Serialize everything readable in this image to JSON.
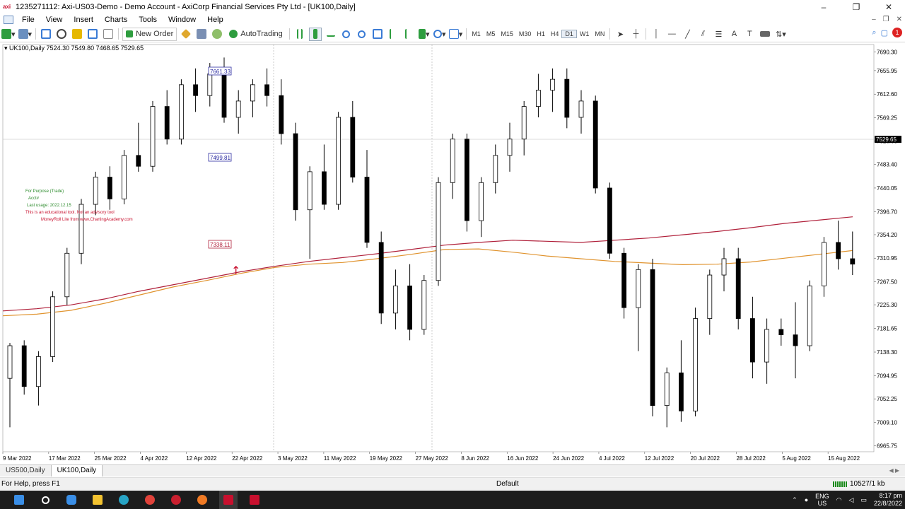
{
  "window": {
    "title": "1235271112: Axi-US03-Demo - Demo Account - AxiCorp Financial Services Pty Ltd - [UK100,Daily]",
    "logo": "axi",
    "min": "–",
    "max": "❐",
    "close": "✕"
  },
  "menu": [
    "File",
    "View",
    "Insert",
    "Charts",
    "Tools",
    "Window",
    "Help"
  ],
  "toolbar": {
    "new_order": "New Order",
    "autotrading": "AutoTrading",
    "timeframes": [
      "M1",
      "M5",
      "M15",
      "M30",
      "H1",
      "H4",
      "D1",
      "W1",
      "MN"
    ],
    "active_timeframe": "D1",
    "text_tool": "A",
    "alert_count": "1"
  },
  "chart": {
    "header": "UK100,Daily  7524.30 7549.80 7468.65 7529.65",
    "annotations": {
      "high_label": "7661.33",
      "mid_label": "7499.81",
      "low_label": "7338.11",
      "overlay_line1": "For Purpose (Trade)",
      "overlay_line2": "Acct#",
      "overlay_line3": "Last usage: 2022.12.15",
      "overlay_line4": "This is an educational tool. Not an advisory tool",
      "overlay_line5": "MoneyRoll Lite from www.ChartingAcademy.com"
    },
    "current_price": "7529.65"
  },
  "chart_data": {
    "type": "candlestick",
    "symbol": "UK100",
    "timeframe": "Daily",
    "y_ticks": [
      "7690.30",
      "7655.95",
      "7612.60",
      "7569.25",
      "7526.65",
      "7483.40",
      "7440.05",
      "7396.70",
      "7354.20",
      "7310.95",
      "7267.50",
      "7225.30",
      "7181.65",
      "7138.30",
      "7094.95",
      "7052.25",
      "7009.10",
      "6965.75"
    ],
    "ylim": [
      6955,
      7700
    ],
    "x_ticks": [
      "9 Mar 2022",
      "17 Mar 2022",
      "25 Mar 2022",
      "4 Apr 2022",
      "12 Apr 2022",
      "22 Apr 2022",
      "3 May 2022",
      "11 May 2022",
      "19 May 2022",
      "27 May 2022",
      "8 Jun 2022",
      "16 Jun 2022",
      "24 Jun 2022",
      "4 Jul 2022",
      "12 Jul 2022",
      "20 Jul 2022",
      "28 Jul 2022",
      "5 Aug 2022",
      "15 Aug 2022"
    ],
    "ma_red": [
      7214,
      7218,
      7225,
      7236,
      7250,
      7262,
      7274,
      7286,
      7296,
      7305,
      7312,
      7319,
      7327,
      7335,
      7340,
      7344,
      7342,
      7340,
      7344,
      7348,
      7354,
      7360,
      7367,
      7375,
      7381,
      7387
    ],
    "ma_orange": [
      7205,
      7208,
      7215,
      7228,
      7243,
      7258,
      7270,
      7283,
      7294,
      7300,
      7303,
      7310,
      7318,
      7327,
      7328,
      7322,
      7315,
      7310,
      7305,
      7302,
      7299,
      7300,
      7304,
      7311,
      7318,
      7325
    ],
    "candles": [
      [
        7090,
        7155,
        7000,
        7150
      ],
      [
        7150,
        7160,
        7060,
        7075
      ],
      [
        7075,
        7140,
        7040,
        7130
      ],
      [
        7130,
        7250,
        7120,
        7240
      ],
      [
        7240,
        7330,
        7225,
        7320
      ],
      [
        7320,
        7420,
        7300,
        7410
      ],
      [
        7410,
        7470,
        7390,
        7460
      ],
      [
        7460,
        7480,
        7400,
        7420
      ],
      [
        7420,
        7510,
        7410,
        7500
      ],
      [
        7500,
        7560,
        7470,
        7480
      ],
      [
        7480,
        7600,
        7470,
        7590
      ],
      [
        7590,
        7620,
        7520,
        7530
      ],
      [
        7530,
        7640,
        7520,
        7630
      ],
      [
        7630,
        7660,
        7580,
        7610
      ],
      [
        7610,
        7670,
        7590,
        7650
      ],
      [
        7650,
        7680,
        7560,
        7570
      ],
      [
        7570,
        7620,
        7540,
        7600
      ],
      [
        7600,
        7640,
        7570,
        7630
      ],
      [
        7630,
        7660,
        7590,
        7610
      ],
      [
        7610,
        7640,
        7520,
        7540
      ],
      [
        7540,
        7560,
        7380,
        7400
      ],
      [
        7400,
        7480,
        7310,
        7470
      ],
      [
        7470,
        7520,
        7400,
        7410
      ],
      [
        7410,
        7580,
        7400,
        7570
      ],
      [
        7570,
        7600,
        7450,
        7460
      ],
      [
        7460,
        7510,
        7330,
        7340
      ],
      [
        7340,
        7360,
        7190,
        7210
      ],
      [
        7210,
        7290,
        7180,
        7260
      ],
      [
        7260,
        7300,
        7160,
        7180
      ],
      [
        7180,
        7280,
        7170,
        7270
      ],
      [
        7270,
        7460,
        7260,
        7450
      ],
      [
        7450,
        7540,
        7420,
        7530
      ],
      [
        7530,
        7540,
        7360,
        7380
      ],
      [
        7380,
        7460,
        7350,
        7450
      ],
      [
        7450,
        7520,
        7430,
        7500
      ],
      [
        7500,
        7560,
        7470,
        7530
      ],
      [
        7530,
        7600,
        7500,
        7590
      ],
      [
        7590,
        7650,
        7570,
        7620
      ],
      [
        7620,
        7660,
        7580,
        7640
      ],
      [
        7640,
        7660,
        7550,
        7570
      ],
      [
        7570,
        7620,
        7540,
        7600
      ],
      [
        7600,
        7610,
        7430,
        7440
      ],
      [
        7440,
        7450,
        7310,
        7320
      ],
      [
        7320,
        7330,
        7200,
        7220
      ],
      [
        7220,
        7300,
        7140,
        7290
      ],
      [
        7290,
        7310,
        7020,
        7040
      ],
      [
        7040,
        7110,
        7000,
        7100
      ],
      [
        7100,
        7160,
        7010,
        7030
      ],
      [
        7030,
        7220,
        7020,
        7200
      ],
      [
        7200,
        7290,
        7170,
        7280
      ],
      [
        7280,
        7330,
        7250,
        7310
      ],
      [
        7310,
        7330,
        7180,
        7200
      ],
      [
        7200,
        7240,
        7090,
        7120
      ],
      [
        7120,
        7200,
        7080,
        7180
      ],
      [
        7180,
        7200,
        7150,
        7170
      ],
      [
        7170,
        7230,
        7090,
        7150
      ],
      [
        7150,
        7270,
        7140,
        7260
      ],
      [
        7260,
        7350,
        7240,
        7340
      ],
      [
        7340,
        7380,
        7290,
        7310
      ],
      [
        7310,
        7360,
        7280,
        7300
      ]
    ]
  },
  "tabs": [
    "US500,Daily",
    "UK100,Daily"
  ],
  "active_tab": "UK100,Daily",
  "status": {
    "help": "For Help, press F1",
    "profile": "Default",
    "traffic": "10527/1 kb"
  },
  "taskbar": {
    "lang": "ENG",
    "lang_sub": "US",
    "time": "8:17 pm",
    "date": "22/8/2022"
  }
}
